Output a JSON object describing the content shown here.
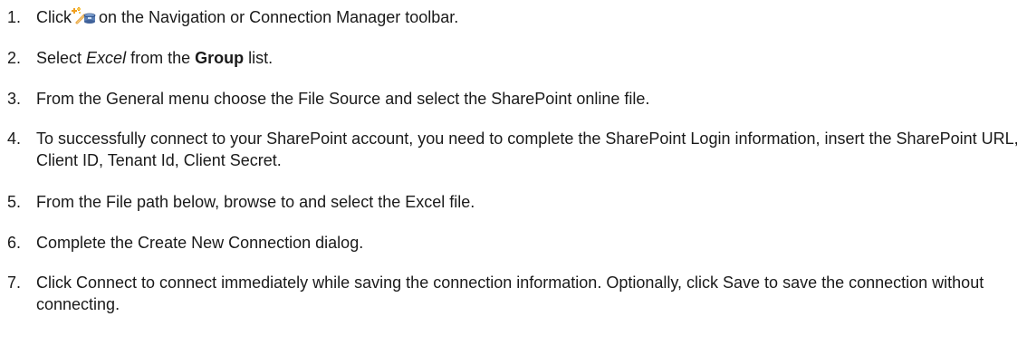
{
  "steps": [
    {
      "number": "1.",
      "before": "Click",
      "icon": "new-connection-icon",
      "after": "on the Navigation or Connection Manager toolbar."
    },
    {
      "number": "2.",
      "before": "Select",
      "em": "Excel",
      "middle": "from the",
      "strong": "Group",
      "after": "list."
    },
    {
      "number": "3.",
      "text": "From the General menu choose the File Source and select the SharePoint online file."
    },
    {
      "number": "4.",
      "text": "To successfully connect to your SharePoint account, you need to complete the SharePoint Login information, insert the SharePoint URL, Client ID, Tenant Id, Client Secret."
    },
    {
      "number": "5.",
      "text": "From the File path below, browse to and select the Excel file."
    },
    {
      "number": "6.",
      "text": "Complete the Create New Connection dialog."
    },
    {
      "number": "7.",
      "text": "Click Connect to connect immediately while saving the connection information. Optionally, click Save to save the connection without connecting."
    }
  ],
  "colors": {
    "text": "#1a1a1a",
    "icon_star": "#f0a020",
    "icon_plug": "#5a7fb5"
  }
}
